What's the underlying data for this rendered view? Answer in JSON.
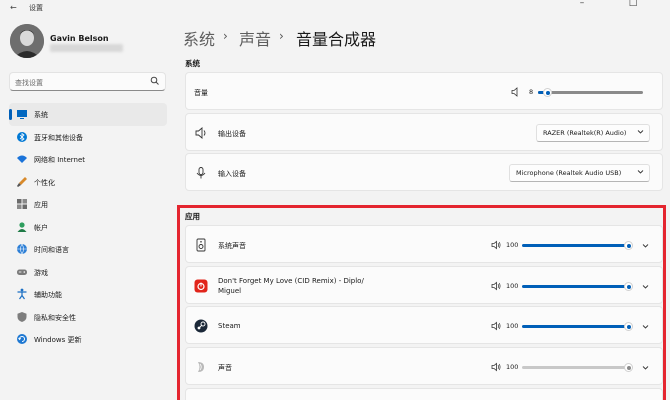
{
  "window": {
    "title": "设置",
    "controls": [
      "–",
      "□",
      "✕"
    ]
  },
  "profile": {
    "name": "Gavin Belson"
  },
  "search": {
    "placeholder": "查找设置"
  },
  "sidebar": {
    "items": [
      {
        "label": "系统",
        "icon": "system-icon",
        "active": true
      },
      {
        "label": "蓝牙和其他设备",
        "icon": "bluetooth-icon"
      },
      {
        "label": "网络和 Internet",
        "icon": "wifi-icon"
      },
      {
        "label": "个性化",
        "icon": "brush-icon"
      },
      {
        "label": "应用",
        "icon": "apps-icon"
      },
      {
        "label": "帐户",
        "icon": "account-icon"
      },
      {
        "label": "时间和语言",
        "icon": "globe-clock-icon"
      },
      {
        "label": "游戏",
        "icon": "gamepad-icon"
      },
      {
        "label": "辅助功能",
        "icon": "accessibility-icon"
      },
      {
        "label": "隐私和安全性",
        "icon": "shield-icon"
      },
      {
        "label": "Windows 更新",
        "icon": "update-icon"
      }
    ]
  },
  "breadcrumb": {
    "items": [
      "系统",
      "声音",
      "音量合成器"
    ],
    "separator": "›"
  },
  "system_section": {
    "title": "系统",
    "volume": {
      "label": "音量",
      "value": "8",
      "level": 0.08
    },
    "output": {
      "label": "输出设备",
      "selected": "RAZER (Realtek(R) Audio)"
    },
    "input": {
      "label": "输入设备",
      "selected": "Microphone (Realtek Audio USB)"
    }
  },
  "apps_section": {
    "title": "应用",
    "apps": [
      {
        "name": "系统声音",
        "icon": "speaker-box-icon",
        "volume": "100",
        "level": 1.0,
        "active": true
      },
      {
        "name": "Don't Forget My Love (CID Remix) - Diplo/\nMiguel",
        "icon": "netease-music-icon",
        "volume": "100",
        "level": 1.0,
        "active": true
      },
      {
        "name": "Steam",
        "icon": "steam-icon",
        "volume": "100",
        "level": 1.0,
        "active": true
      },
      {
        "name": "声音",
        "icon": "sound-app-icon",
        "volume": "100",
        "level": 1.0,
        "active": false
      }
    ]
  },
  "colors": {
    "accent": "#005fb8",
    "highlight_border": "#e4252f",
    "background": "#f3f3f3",
    "card": "#fbfbfb"
  }
}
